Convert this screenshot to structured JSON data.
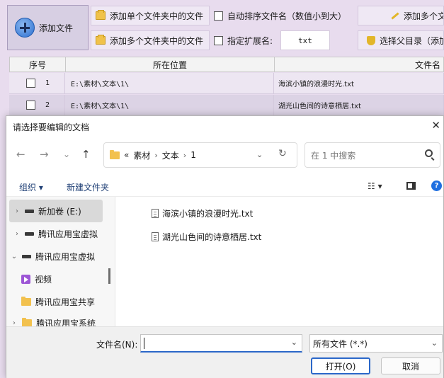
{
  "app": {
    "add_file_label": "添加文件",
    "add_single_folder_label": "添加单个文件夹中的文件",
    "add_multi_folder_label": "添加多个文件夹中的文件",
    "auto_sort_label": "自动排序文件名（数值小到大）",
    "ext_label": "指定扩展名:",
    "ext_value": "txt",
    "add_multi_right_label": "添加多个文",
    "choose_parent_label": "选择父目录（添加",
    "columns": {
      "no": "序号",
      "location": "所在位置",
      "filename": "文件名"
    },
    "rows": [
      {
        "no": "1",
        "location": "E:\\素材\\文本\\1\\",
        "filename": "海滨小镇的浪漫时光.txt"
      },
      {
        "no": "2",
        "location": "E:\\素材\\文本\\1\\",
        "filename": "湖光山色间的诗意栖居.txt"
      }
    ]
  },
  "dialog": {
    "title": "请选择要编辑的文档",
    "close_glyph": "✕",
    "nav": {
      "back": "←",
      "forward": "→",
      "recent": "⌄",
      "up": "↑"
    },
    "address": {
      "overflow": "«",
      "parts": [
        "素材",
        "文本",
        "1"
      ],
      "separator": "›",
      "refresh": "↻",
      "chevron": "⌄"
    },
    "search_placeholder": "在 1 中搜索",
    "commands": {
      "organize": "组织 ▾",
      "new_folder": "新建文件夹",
      "view_glyph": "☷ ▾"
    },
    "nav_pane": [
      {
        "label": "新加卷 (E:)",
        "caret": "›",
        "icon": "drive-icon",
        "selected": true
      },
      {
        "label": "腾讯应用宝虚拟",
        "caret": "›",
        "icon": "drive-icon",
        "selected": false
      },
      {
        "label": "腾讯应用宝虚拟",
        "caret": "⌄",
        "icon": "drive-icon",
        "selected": false
      },
      {
        "label": "视频",
        "caret": "",
        "icon": "video-icon",
        "selected": false
      },
      {
        "label": "腾讯应用宝共享",
        "caret": "",
        "icon": "folder-icon",
        "selected": false
      },
      {
        "label": "腾讯应用宝系统",
        "caret": "›",
        "icon": "folder-icon",
        "selected": false
      }
    ],
    "files": [
      "海滨小镇的浪漫时光.txt",
      "湖光山色间的诗意栖居.txt"
    ],
    "footer": {
      "filename_label": "文件名(N):",
      "filename_value": "",
      "filter_value": "所有文件 (*.*)",
      "open_label": "打开(O)",
      "cancel_label": "取消"
    }
  },
  "colors": {
    "app_bg": "#e8dcee",
    "accent": "#2b67c9",
    "folder": "#f2c14e"
  }
}
